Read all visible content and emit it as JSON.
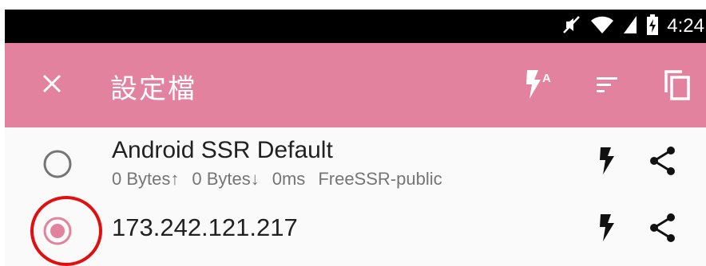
{
  "statusbar": {
    "time": "4:24",
    "icons": [
      "mute-icon",
      "wifi-icon",
      "signal-icon",
      "battery-charging-icon"
    ]
  },
  "appbar": {
    "title": "設定檔",
    "close_icon": "close-icon",
    "actions": [
      "flash-auto-icon",
      "sort-icon",
      "copy-icon"
    ]
  },
  "profiles": [
    {
      "name": "Android SSR Default",
      "selected": false,
      "upload": "0 Bytes↑",
      "download": "0 Bytes↓",
      "latency": "0ms",
      "group": "FreeSSR-public"
    },
    {
      "name": "173.242.121.217",
      "selected": true
    }
  ],
  "colors": {
    "appbar": "#e3829f",
    "statusbar": "#000000",
    "radio_selected": "#e3829f",
    "radio_unselected": "#757575",
    "annotation": "#e01010"
  }
}
